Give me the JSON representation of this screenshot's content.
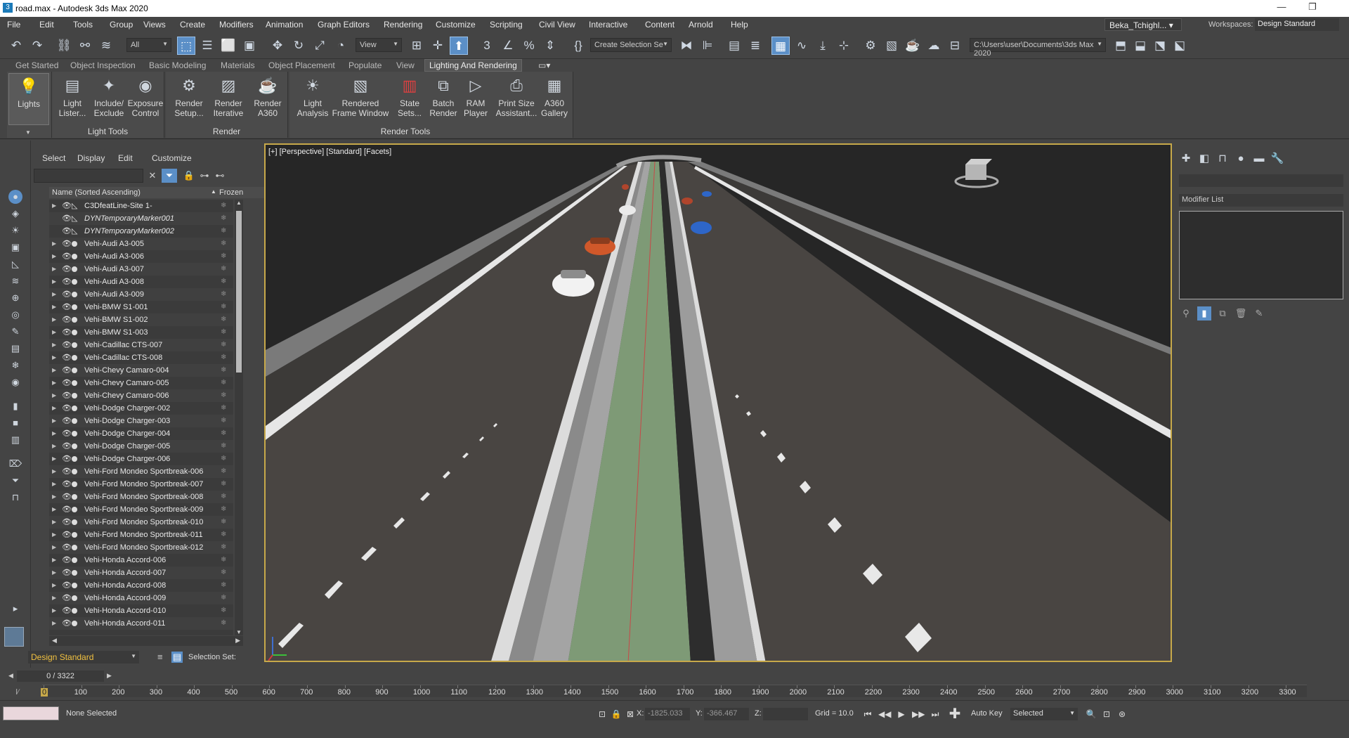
{
  "window": {
    "title": "road.max - Autodesk 3ds Max 2020",
    "app_icon": "3",
    "minimize": "—",
    "restore": "❐"
  },
  "menubar": {
    "items": [
      "File",
      "Edit",
      "Tools",
      "Group",
      "Views",
      "Create",
      "Modifiers",
      "Animation",
      "Graph Editors",
      "Rendering",
      "Customize",
      "Scripting",
      "Civil View",
      "Interactive",
      "Content",
      "Arnold",
      "Help"
    ],
    "user": "Beka_Tchighl...",
    "workspaces_label": "Workspaces:",
    "workspace": "Design Standard"
  },
  "toolbar": {
    "selection_filter": "All",
    "ref_coord": "View",
    "selection_set": "Create Selection Se",
    "project_path": "C:\\Users\\user\\Documents\\3ds Max 2020"
  },
  "ribbon_tabs": [
    "Get Started",
    "Object Inspection",
    "Basic Modeling",
    "Materials",
    "Object Placement",
    "Populate",
    "View",
    "Lighting And Rendering"
  ],
  "ribbon": {
    "lights": {
      "l1": "Lights"
    },
    "groups": [
      {
        "label": "Light Tools",
        "buttons": [
          {
            "l1": "Light",
            "l2": "Lister..."
          },
          {
            "l1": "Include/",
            "l2": "Exclude"
          },
          {
            "l1": "Exposure",
            "l2": "Control"
          }
        ]
      },
      {
        "label": "Render",
        "buttons": [
          {
            "l1": "Render",
            "l2": "Setup..."
          },
          {
            "l1": "Render",
            "l2": "Iterative"
          },
          {
            "l1": "Render",
            "l2": "A360"
          }
        ]
      },
      {
        "label": "Render Tools",
        "buttons": [
          {
            "l1": "Light",
            "l2": "Analysis"
          },
          {
            "l1": "Rendered",
            "l2": "Frame Window"
          },
          {
            "l1": "State",
            "l2": "Sets..."
          },
          {
            "l1": "Batch",
            "l2": "Render"
          },
          {
            "l1": "RAM",
            "l2": "Player"
          },
          {
            "l1": "Print Size",
            "l2": "Assistant..."
          },
          {
            "l1": "A360",
            "l2": "Gallery"
          }
        ]
      }
    ]
  },
  "explorer": {
    "menus": [
      "Select",
      "Display",
      "Edit",
      "Customize"
    ],
    "header_name": "Name (Sorted Ascending)",
    "header_sort": "▲",
    "header_frozen": "Frozen",
    "rows": [
      "C3DfeatLine-Site 1-",
      "DYNTemporaryMarker001",
      "DYNTemporaryMarker002",
      "Vehi-Audi A3-005",
      "Vehi-Audi A3-006",
      "Vehi-Audi A3-007",
      "Vehi-Audi A3-008",
      "Vehi-Audi A3-009",
      "Vehi-BMW S1-001",
      "Vehi-BMW S1-002",
      "Vehi-BMW S1-003",
      "Vehi-Cadillac CTS-007",
      "Vehi-Cadillac CTS-008",
      "Vehi-Chevy Camaro-004",
      "Vehi-Chevy Camaro-005",
      "Vehi-Chevy Camaro-006",
      "Vehi-Dodge Charger-002",
      "Vehi-Dodge Charger-003",
      "Vehi-Dodge Charger-004",
      "Vehi-Dodge Charger-005",
      "Vehi-Dodge Charger-006",
      "Vehi-Ford Mondeo Sportbreak-006",
      "Vehi-Ford Mondeo Sportbreak-007",
      "Vehi-Ford Mondeo Sportbreak-008",
      "Vehi-Ford Mondeo Sportbreak-009",
      "Vehi-Ford Mondeo Sportbreak-010",
      "Vehi-Ford Mondeo Sportbreak-011",
      "Vehi-Ford Mondeo Sportbreak-012",
      "Vehi-Honda Accord-006",
      "Vehi-Honda Accord-007",
      "Vehi-Honda Accord-008",
      "Vehi-Honda Accord-009",
      "Vehi-Honda Accord-010",
      "Vehi-Honda Accord-011"
    ],
    "layer_dropdown": "Design Standard",
    "selection_set_label": "Selection Set:"
  },
  "viewport": {
    "label": "[+] [Perspective] [Standard] [Facets]"
  },
  "command_panel": {
    "modifier_list": "Modifier List"
  },
  "timeline": {
    "frame": "0 / 3322",
    "ticks": [
      "0",
      "100",
      "200",
      "300",
      "400",
      "500",
      "600",
      "700",
      "800",
      "900",
      "1000",
      "1100",
      "1200",
      "1300",
      "1400",
      "1500",
      "1600",
      "1700",
      "1800",
      "1900",
      "2000",
      "2100",
      "2200",
      "2300",
      "2400",
      "2500",
      "2600",
      "2700",
      "2800",
      "2900",
      "3000",
      "3100",
      "3200",
      "3300"
    ]
  },
  "status": {
    "selection": "None Selected",
    "x_label": "X:",
    "x_value": "-1825.033",
    "y_label": "Y:",
    "y_value": "-366.467",
    "z_label": "Z:",
    "z_value": "",
    "grid": "Grid = 10.0",
    "auto_key": "Auto Key",
    "key_mode": "Selected"
  },
  "colors": {
    "accent": "#5b8fc7",
    "viewport_border": "#c7a94a",
    "layer_text": "#f0c040"
  }
}
